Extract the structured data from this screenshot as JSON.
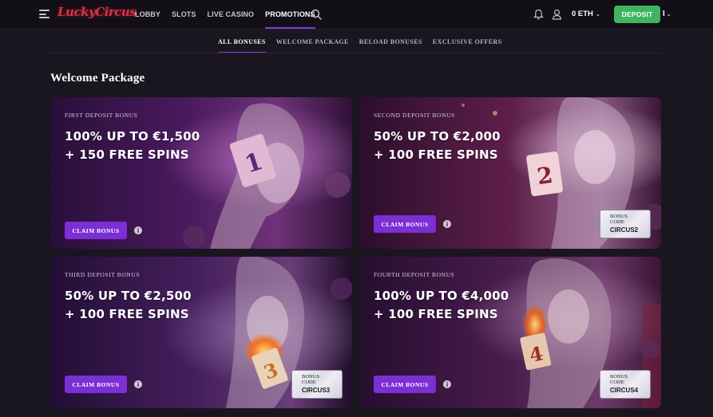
{
  "header": {
    "logo": "LuckyCircus",
    "nav": [
      "LOBBY",
      "SLOTS",
      "LIVE CASINO",
      "PROMOTIONS"
    ],
    "active_nav": "PROMOTIONS",
    "balance": "0 ETH",
    "deposit_label": "DEPOSIT",
    "lang": "I",
    "colors": {
      "accent": "#7b3fd6",
      "deposit": "#3fb560",
      "logo": "#e0304a"
    }
  },
  "subtabs": [
    "ALL BONUSES",
    "WELCOME PACKAGE",
    "RELOAD BONUSES",
    "EXCLUSIVE OFFERS"
  ],
  "section_title": "Welcome Package",
  "cards": [
    {
      "eyebrow": "FIRST DEPOSIT BONUS",
      "line1": "100% UP TO €1,500",
      "line2": "+ 150 FREE SPINS",
      "cta": "CLAIM BONUS",
      "card_number": "1"
    },
    {
      "eyebrow": "SECOND DEPOSIT BONUS",
      "line1": "50% UP TO €2,000",
      "line2": "+ 100 FREE SPINS",
      "cta": "CLAIM BONUS",
      "code_label_1": "BONUS",
      "code_label_2": "CODE",
      "code": "CIRCUS2",
      "card_number": "2"
    },
    {
      "eyebrow": "THIRD DEPOSIT BONUS",
      "line1": "50% UP TO €2,500",
      "line2": "+ 100 FREE SPINS",
      "cta": "CLAIM BONUS",
      "code_label_1": "BONUS",
      "code_label_2": "CODE",
      "code": "CIRCUS3",
      "card_number": "3"
    },
    {
      "eyebrow": "FOURTH DEPOSIT BONUS",
      "line1": "100% UP TO €4,000",
      "line2": "+ 100 FREE SPINS",
      "cta": "CLAIM BONUS",
      "code_label_1": "BONUS",
      "code_label_2": "CODE",
      "code": "CIRCUS4",
      "card_number": "4"
    }
  ]
}
